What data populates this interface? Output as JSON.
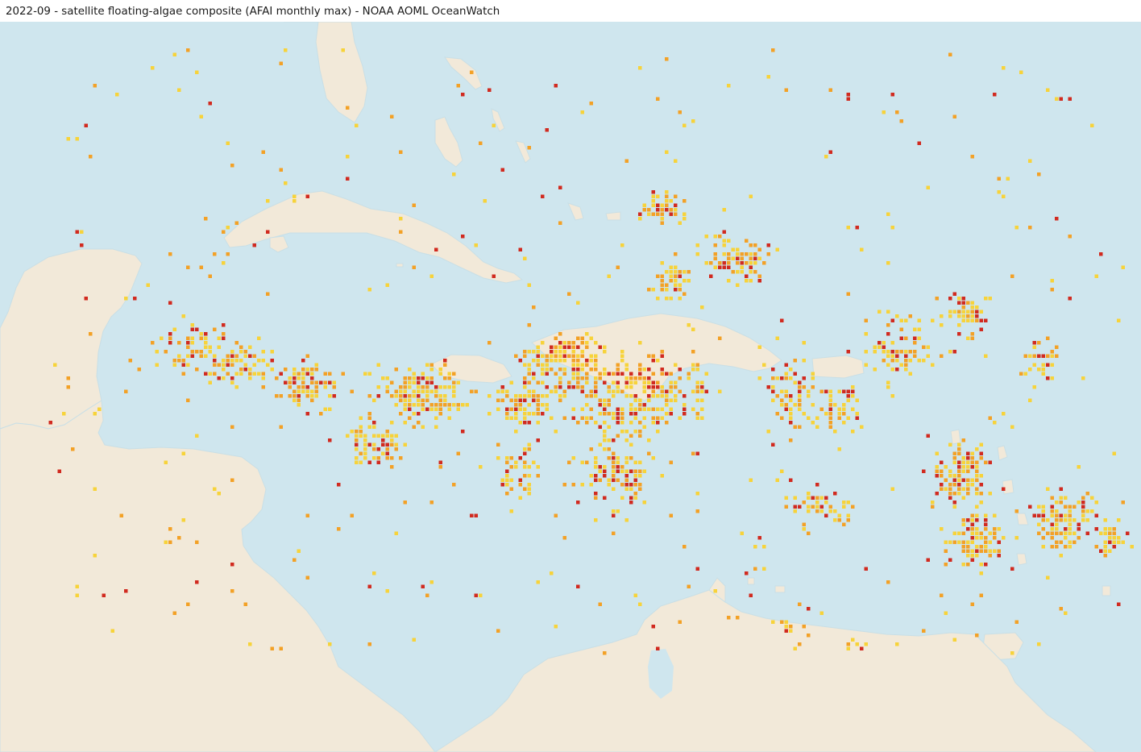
{
  "title": "2022-09 - satellite floating-algae composite (AFAI monthly max) - NOAA AOML OceanWatch",
  "map": {
    "region": "Caribbean Sea and Gulf of Mexico",
    "colors": {
      "ocean": "#cfe6ee",
      "land": "#f2e9d9",
      "coast": "#c9dfe6",
      "algae_low": "#f7d33a",
      "algae_mid": "#f3a126",
      "algae_high": "#d12a1f"
    },
    "icons": [
      "algae-pixel-icon"
    ]
  }
}
